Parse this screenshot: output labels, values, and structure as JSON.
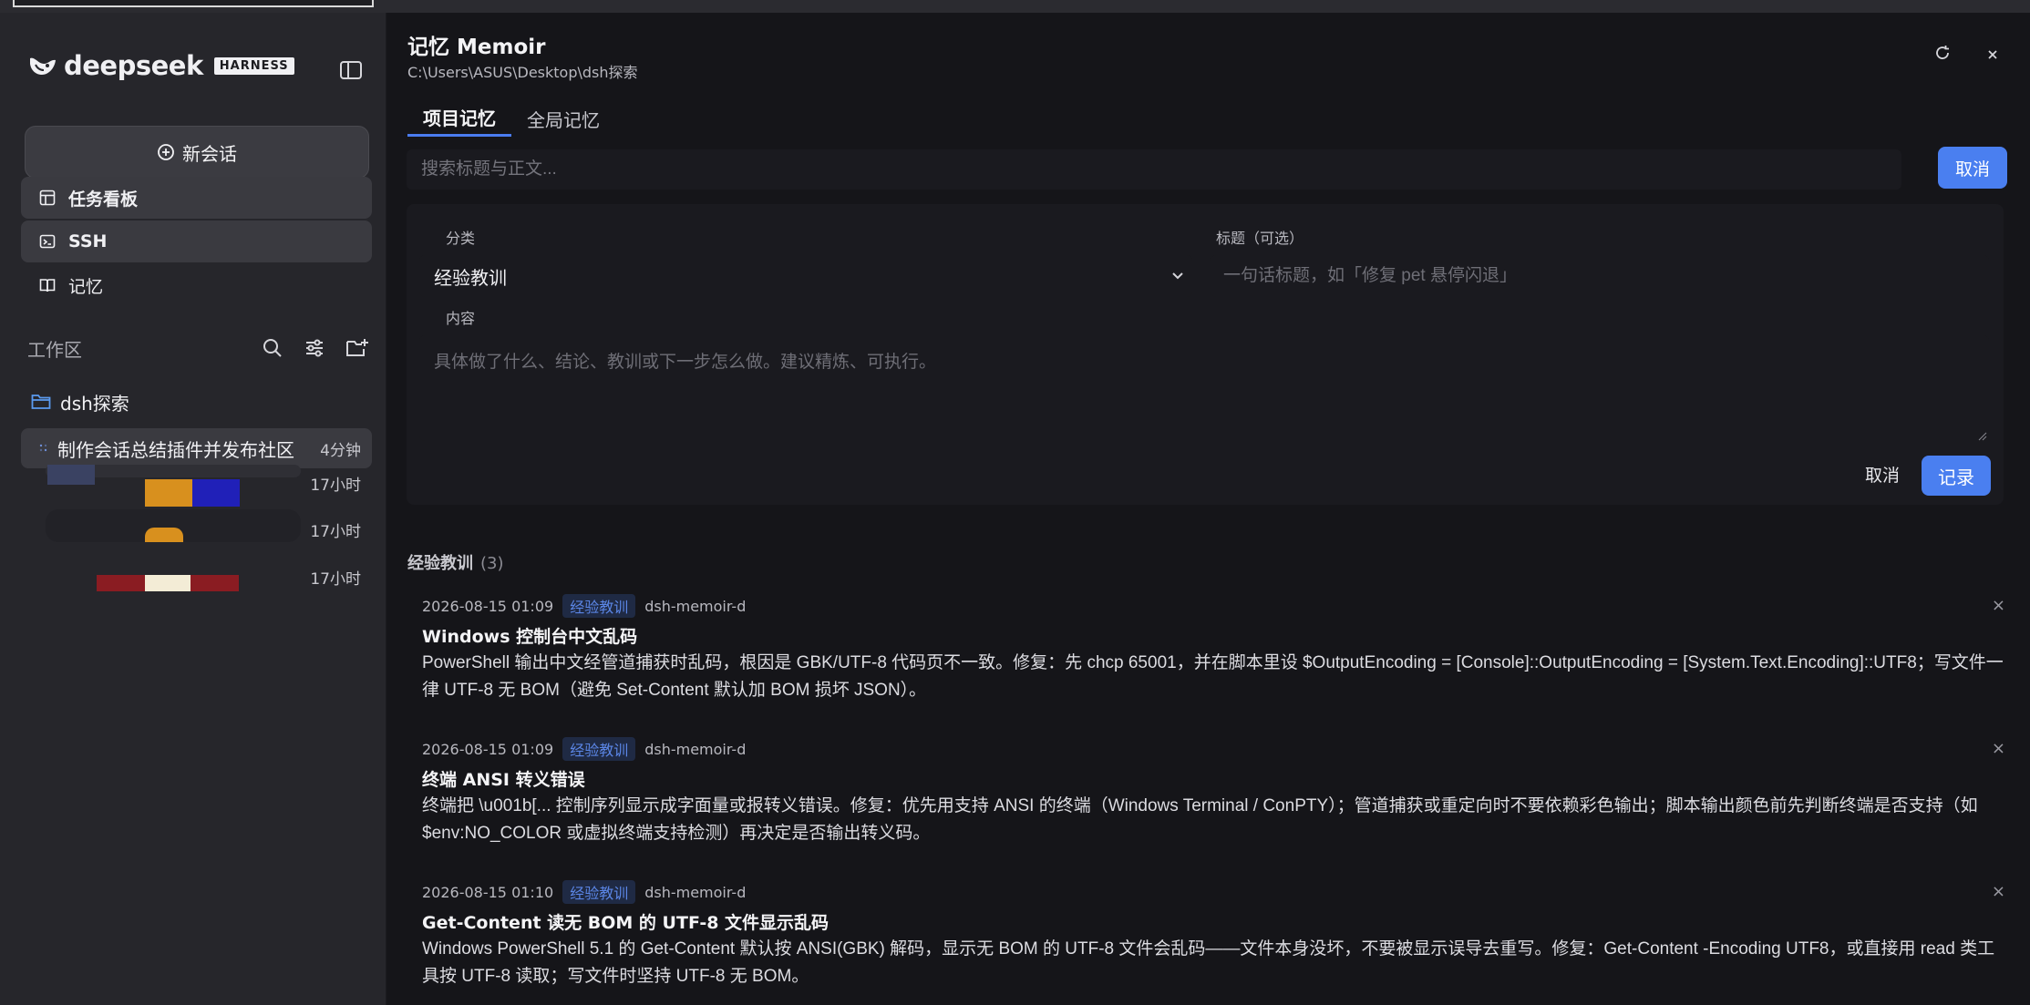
{
  "app": {
    "logo_text": "deepseek",
    "badge": "HARNESS"
  },
  "sidebar": {
    "new_chat": "新会话",
    "items": [
      {
        "label": "任务看板",
        "icon": "board-icon",
        "active": true
      },
      {
        "label": "SSH",
        "icon": "terminal-icon",
        "active": true
      },
      {
        "label": "记忆",
        "icon": "book-icon",
        "active": false
      }
    ],
    "workspace_label": "工作区",
    "folder": "dsh探索",
    "sessions": [
      {
        "title": "制作会话总结插件并发布社区",
        "time": "4分钟"
      },
      {
        "title": "",
        "time": "17小时"
      },
      {
        "title": "",
        "time": "17小时"
      },
      {
        "title": "",
        "time": "17小时"
      }
    ]
  },
  "main": {
    "title": "记忆 Memoir",
    "path": "C:\\Users\\ASUS\\Desktop\\dsh探索",
    "tabs": [
      {
        "label": "项目记忆",
        "active": true
      },
      {
        "label": "全局记忆",
        "active": false
      }
    ],
    "search_placeholder": "搜索标题与正文...",
    "cancel_top": "取消",
    "form": {
      "category_label": "分类",
      "category_value": "经验教训",
      "title_label": "标题（可选）",
      "title_placeholder": "一句话标题，如「修复 pet 悬停闪退」",
      "content_label": "内容",
      "content_placeholder": "具体做了什么、结论、教训或下一步怎么做。建议精炼、可执行。",
      "cancel": "取消",
      "save": "记录"
    },
    "list": {
      "heading": "经验教训",
      "count": "(3)",
      "entries": [
        {
          "date": "2026-08-15 01:09",
          "tag": "经验教训",
          "source": "dsh-memoir-d",
          "title": "Windows 控制台中文乱码",
          "body": "PowerShell 输出中文经管道捕获时乱码，根因是 GBK/UTF-8 代码页不一致。修复：先 chcp 65001，并在脚本里设 $OutputEncoding = [Console]::OutputEncoding = [System.Text.Encoding]::UTF8；写文件一律 UTF-8 无 BOM（避免 Set-Content 默认加 BOM 损坏 JSON）。"
        },
        {
          "date": "2026-08-15 01:09",
          "tag": "经验教训",
          "source": "dsh-memoir-d",
          "title": "终端 ANSI 转义错误",
          "body": "终端把 \\u001b[... 控制序列显示成字面量或报转义错误。修复：优先用支持 ANSI 的终端（Windows Terminal / ConPTY）；管道捕获或重定向时不要依赖彩色输出；脚本输出颜色前先判断终端是否支持（如 $env:NO_COLOR 或虚拟终端支持检测）再决定是否输出转义码。"
        },
        {
          "date": "2026-08-15 01:10",
          "tag": "经验教训",
          "source": "dsh-memoir-d",
          "title": "Get-Content 读无 BOM 的 UTF-8 文件显示乱码",
          "body": "Windows PowerShell 5.1 的 Get-Content 默认按 ANSI(GBK) 解码，显示无 BOM 的 UTF-8 文件会乱码——文件本身没坏，不要被显示误导去重写。修复：Get-Content -Encoding UTF8，或直接用 read 类工具按 UTF-8 读取；写文件时坚持 UTF-8 无 BOM。"
        }
      ]
    }
  },
  "colors": {
    "accent": "#4a7ff0",
    "sidebar_bg": "#26262b",
    "main_bg": "#151519",
    "tag_fg": "#5b86e6"
  }
}
